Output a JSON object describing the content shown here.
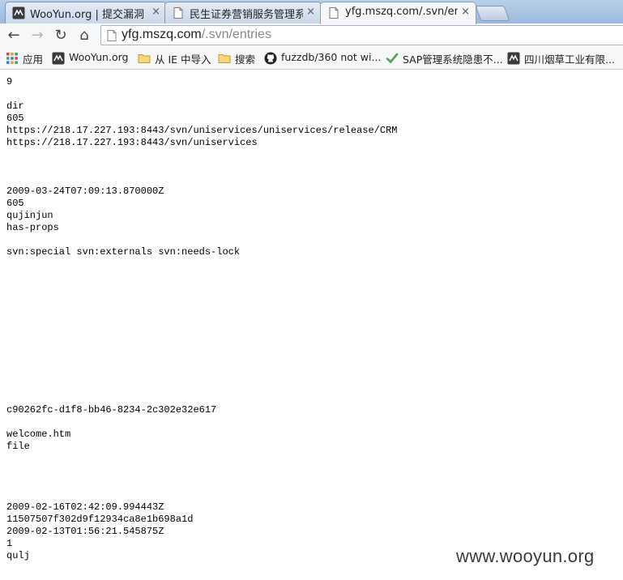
{
  "tabs": [
    {
      "title": "WooYun.org | 提交漏洞",
      "close": "×",
      "icon": "wooyun-favicon",
      "active": false
    },
    {
      "title": "民生证券营销服务管理系统",
      "close": "×",
      "icon": "page-icon",
      "active": false
    },
    {
      "title": "yfg.mszq.com/.svn/entries",
      "close": "×",
      "icon": "page-icon",
      "active": true
    }
  ],
  "toolbar": {
    "back": "←",
    "forward": "→",
    "reload": "↻",
    "home": "⌂"
  },
  "omnibox": {
    "host": "yfg.mszq.com",
    "path": "/.svn/entries"
  },
  "bookmarks": [
    {
      "label": "应用",
      "icon": "apps-grid-icon"
    },
    {
      "label": "WooYun.org",
      "icon": "wooyun-favicon"
    },
    {
      "label": "从 IE 中导入",
      "icon": "folder-icon"
    },
    {
      "label": "搜索",
      "icon": "folder-icon"
    },
    {
      "label": "fuzzdb/360 not wi...",
      "icon": "github-icon"
    },
    {
      "label": "SAP管理系统隐患不...",
      "icon": "check-icon"
    },
    {
      "label": "四川烟草工业有限...",
      "icon": "wooyun-favicon"
    }
  ],
  "content_lines": [
    "9",
    "",
    "dir",
    "605",
    "https://218.17.227.193:8443/svn/uniservices/uniservices/release/CRM",
    "https://218.17.227.193:8443/svn/uniservices",
    "",
    "",
    "",
    "2009-03-24T07:09:13.870000Z",
    "605",
    "qujinjun",
    "has-props",
    "",
    "svn:special svn:externals svn:needs-lock",
    "",
    "",
    "",
    "",
    "",
    "",
    "",
    "",
    "",
    "",
    "",
    "",
    "c90262fc-d1f8-bb46-8234-2c302e32e617",
    "",
    "welcome.htm",
    "file",
    "",
    "",
    "",
    "",
    "2009-02-16T02:42:09.994443Z",
    "11507507f302d9f12934ca8e1b698a1d",
    "2009-02-13T01:56:21.545875Z",
    "1",
    "qulj"
  ],
  "watermark": "www.wooyun.org"
}
